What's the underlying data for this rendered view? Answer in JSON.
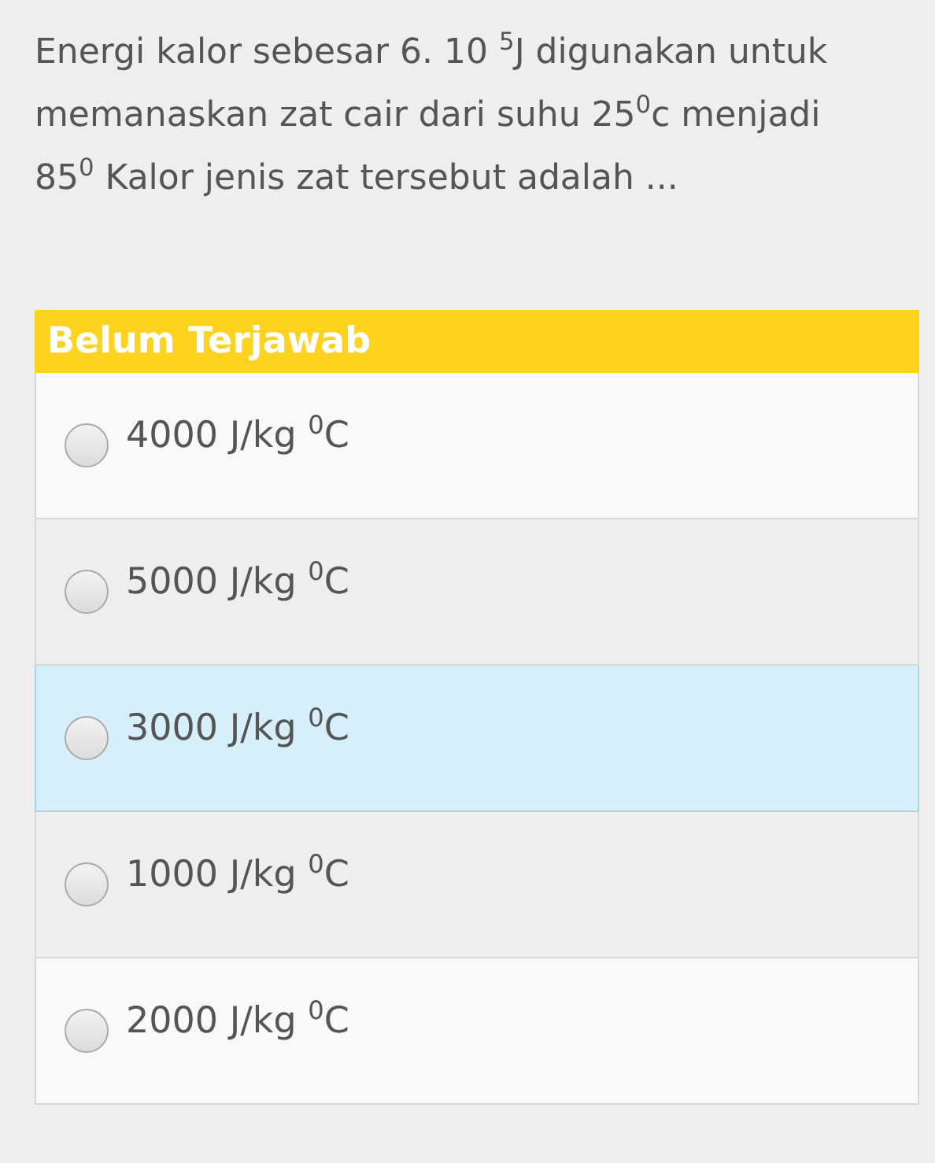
{
  "question": "Energi kalor sebesar 6. 10 $^{5}$J digunakan untuk memanaskan zat cair dari suhu 25$^{0}$c menjadi 85$^{0}$ Kalor jenis zat tersebut adalah ...",
  "status": "Belum Terjawab",
  "options": [
    {
      "label": "4000 J/kg $^{0}$C",
      "checked": false,
      "highlighted": false
    },
    {
      "label": "5000 J/kg $^{0}$C",
      "checked": false,
      "highlighted": false
    },
    {
      "label": "3000 J/kg $^{0}$C",
      "checked": false,
      "highlighted": true
    },
    {
      "label": "1000 J/kg $^{0}$C",
      "checked": false,
      "highlighted": false
    },
    {
      "label": "2000 J/kg $^{0}$C",
      "checked": false,
      "highlighted": false
    }
  ]
}
